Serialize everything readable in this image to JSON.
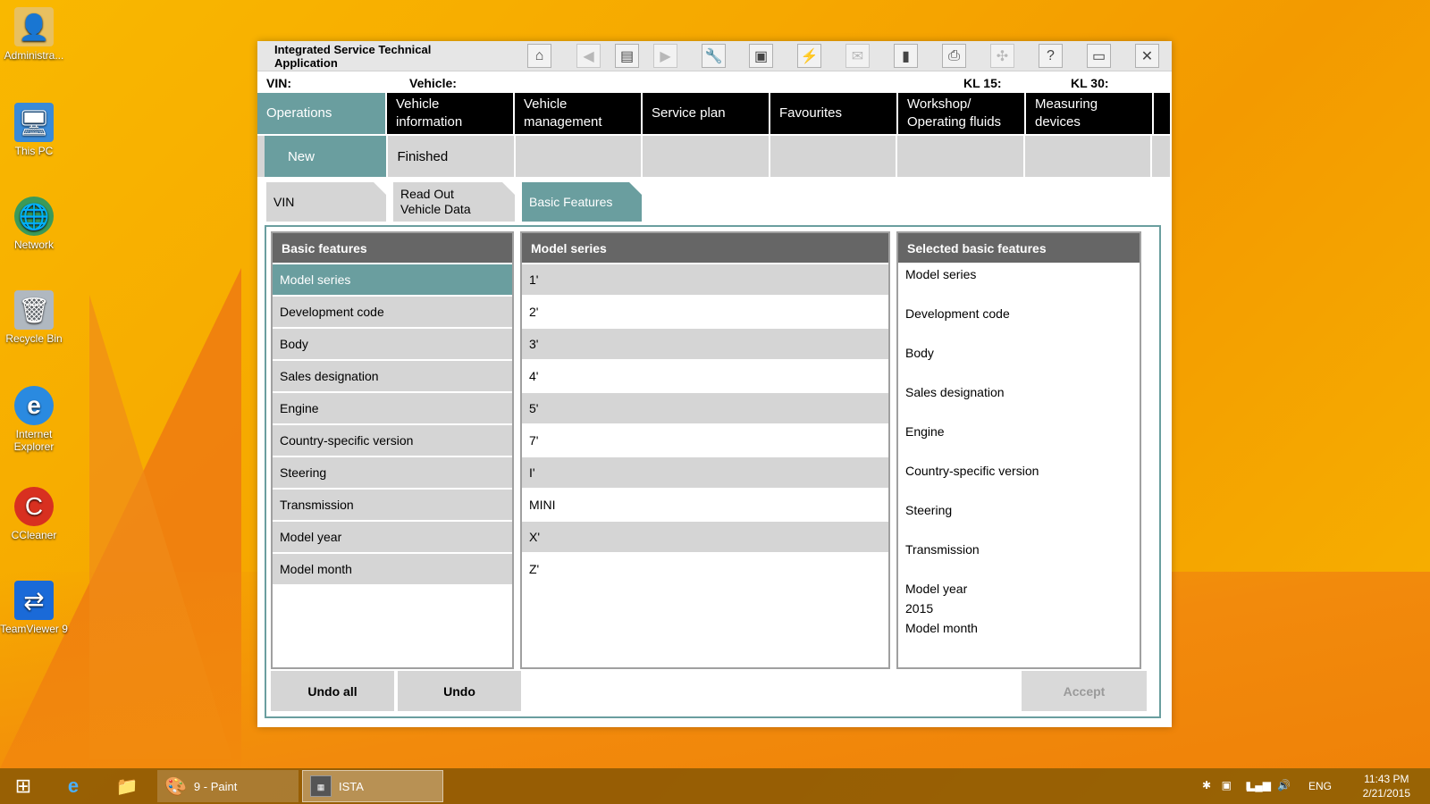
{
  "desktop": {
    "icons": [
      {
        "label": "Administra...",
        "icon": "user-folder-icon"
      },
      {
        "label": "This PC",
        "icon": "computer-icon"
      },
      {
        "label": "Network",
        "icon": "network-icon"
      },
      {
        "label": "Recycle Bin",
        "icon": "recycle-bin-icon"
      },
      {
        "label": "Internet Explorer",
        "icon": "ie-icon"
      },
      {
        "label": "CCleaner",
        "icon": "ccleaner-icon"
      },
      {
        "label": "TeamViewer 9",
        "icon": "teamviewer-icon"
      }
    ]
  },
  "window": {
    "title": "Integrated Service Technical Application",
    "info": {
      "vin_label": "VIN:",
      "vehicle_label": "Vehicle:",
      "kl15_label": "KL 15:",
      "kl30_label": "KL 30:"
    },
    "nav": [
      "Operations",
      "Vehicle information",
      "Vehicle management",
      "Service plan",
      "Favourites",
      "Workshop/ Operating fluids",
      "Measuring devices"
    ],
    "sub_nav": [
      "New",
      "Finished"
    ],
    "tabs": [
      "VIN",
      "Read Out Vehicle Data",
      "Basic Features"
    ],
    "basic_features": {
      "header": "Basic features",
      "items": [
        "Model series",
        "Development code",
        "Body",
        "Sales designation",
        "Engine",
        "Country-specific version",
        "Steering",
        "Transmission",
        "Model year",
        "Model month"
      ]
    },
    "model_series": {
      "header": "Model series",
      "items": [
        "1'",
        "2'",
        "3'",
        "4'",
        "5'",
        "7'",
        "I'",
        "MINI",
        "X'",
        "Z'"
      ]
    },
    "selected": {
      "header": "Selected basic features",
      "items": [
        "Model series",
        "Development code",
        "Body",
        "Sales designation",
        "Engine",
        "Country-specific version",
        "Steering",
        "Transmission",
        "Model year"
      ],
      "model_year_value": "2015",
      "last_item": "Model month"
    },
    "buttons": {
      "undo_all": "Undo all",
      "undo": "Undo",
      "accept": "Accept"
    }
  },
  "taskbar": {
    "paint_label": "9 - Paint",
    "ista_label": "ISTA",
    "lang": "ENG",
    "time": "11:43 PM",
    "date": "2/21/2015"
  },
  "colors": {
    "accent": "#6a9e9f",
    "nav_bg": "#000000",
    "header_bg": "#666666"
  }
}
